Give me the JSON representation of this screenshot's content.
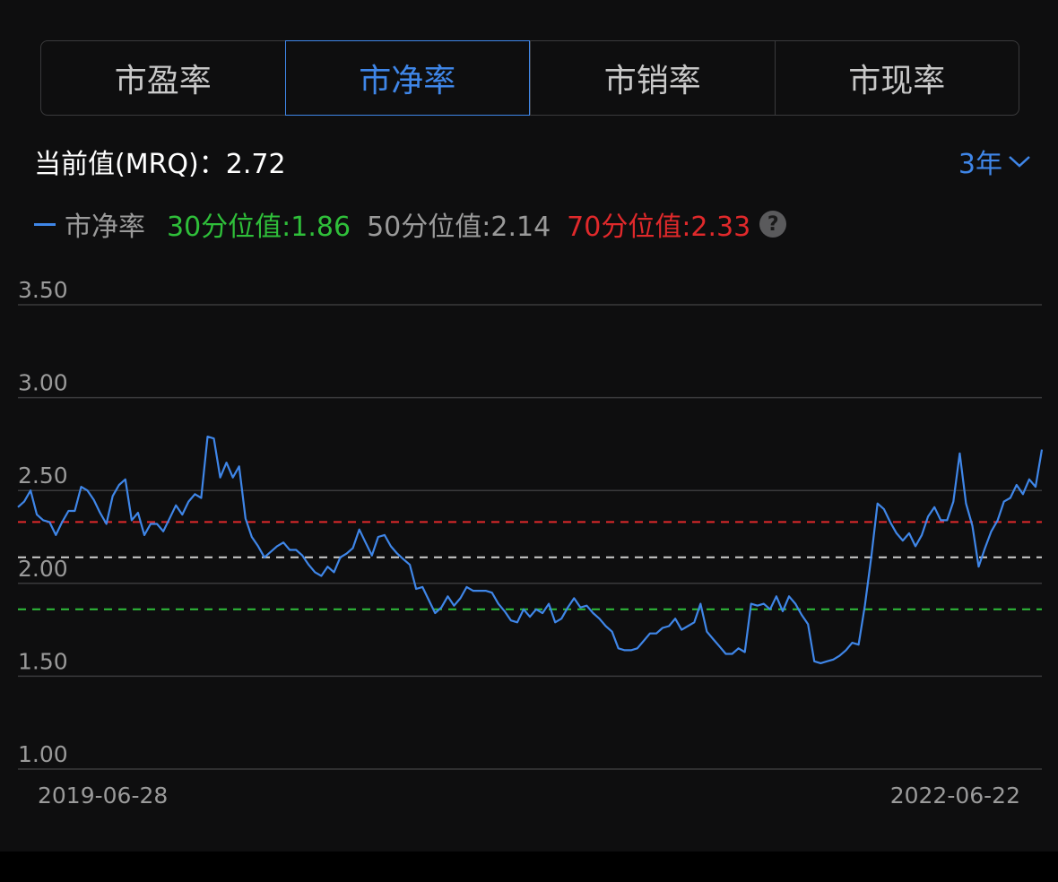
{
  "tabs": [
    {
      "label": "市盈率",
      "active": false
    },
    {
      "label": "市净率",
      "active": true
    },
    {
      "label": "市销率",
      "active": false
    },
    {
      "label": "市现率",
      "active": false
    }
  ],
  "current": {
    "text": "当前值(MRQ)：2.72"
  },
  "range": {
    "label": "3年",
    "icon": "chevron-down-icon"
  },
  "legend": {
    "series_name": "市净率",
    "q30": "30分位值:1.86",
    "q50": "50分位值:2.14",
    "q70": "70分位值:2.33",
    "help_icon": "?"
  },
  "colors": {
    "accent": "#3f86e8",
    "q30": "#2fbf3a",
    "q50": "#cfcfcf",
    "q70": "#e0292b"
  },
  "chart_data": {
    "type": "line",
    "ylim": [
      1.0,
      3.5
    ],
    "yticks": [
      "3.50",
      "3.00",
      "2.50",
      "2.00",
      "1.50",
      "1.00"
    ],
    "ytick_values": [
      3.5,
      3.0,
      2.5,
      2.0,
      1.5,
      1.0
    ],
    "x_start_label": "2019-06-28",
    "x_end_label": "2022-06-22",
    "grid": true,
    "reference_lines": [
      {
        "value": 2.33,
        "color": "#e0292b"
      },
      {
        "value": 2.14,
        "color": "#cfcfcf"
      },
      {
        "value": 1.86,
        "color": "#2fbf3a"
      }
    ],
    "series": [
      {
        "name": "市净率",
        "color": "#3f86e8",
        "values": [
          2.41,
          2.44,
          2.5,
          2.37,
          2.34,
          2.33,
          2.26,
          2.33,
          2.39,
          2.39,
          2.52,
          2.5,
          2.45,
          2.38,
          2.32,
          2.47,
          2.53,
          2.56,
          2.34,
          2.38,
          2.26,
          2.32,
          2.32,
          2.28,
          2.35,
          2.42,
          2.37,
          2.44,
          2.48,
          2.46,
          2.79,
          2.78,
          2.57,
          2.65,
          2.57,
          2.63,
          2.35,
          2.25,
          2.2,
          2.14,
          2.17,
          2.2,
          2.22,
          2.18,
          2.18,
          2.15,
          2.1,
          2.06,
          2.04,
          2.09,
          2.06,
          2.14,
          2.16,
          2.19,
          2.29,
          2.22,
          2.15,
          2.25,
          2.26,
          2.2,
          2.16,
          2.13,
          2.1,
          1.97,
          1.98,
          1.91,
          1.84,
          1.87,
          1.93,
          1.88,
          1.92,
          1.98,
          1.96,
          1.96,
          1.96,
          1.95,
          1.89,
          1.85,
          1.8,
          1.79,
          1.86,
          1.82,
          1.86,
          1.84,
          1.89,
          1.79,
          1.81,
          1.87,
          1.92,
          1.87,
          1.88,
          1.84,
          1.81,
          1.77,
          1.74,
          1.65,
          1.64,
          1.64,
          1.65,
          1.69,
          1.73,
          1.73,
          1.76,
          1.77,
          1.81,
          1.75,
          1.77,
          1.79,
          1.89,
          1.74,
          1.7,
          1.66,
          1.62,
          1.62,
          1.65,
          1.63,
          1.89,
          1.88,
          1.89,
          1.86,
          1.93,
          1.85,
          1.93,
          1.89,
          1.83,
          1.78,
          1.58,
          1.57,
          1.58,
          1.59,
          1.61,
          1.64,
          1.68,
          1.67,
          1.88,
          2.14,
          2.43,
          2.4,
          2.33,
          2.27,
          2.23,
          2.27,
          2.2,
          2.26,
          2.36,
          2.41,
          2.34,
          2.34,
          2.44,
          2.7,
          2.43,
          2.31,
          2.09,
          2.19,
          2.28,
          2.34,
          2.44,
          2.46,
          2.53,
          2.48,
          2.56,
          2.52,
          2.72
        ]
      }
    ]
  }
}
